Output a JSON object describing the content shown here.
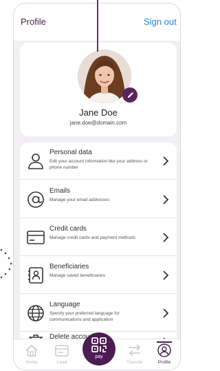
{
  "header": {
    "title": "Profile",
    "sign_out": "Sign out"
  },
  "user": {
    "name": "Jane Doe",
    "email": "jane.doe@domain.com"
  },
  "menu": [
    {
      "icon": "person-icon",
      "title": "Personal data",
      "desc": "Edit your account information like your address or phone number"
    },
    {
      "icon": "at-icon",
      "title": "Emails",
      "desc": "Manage your email addresses"
    },
    {
      "icon": "credit-card-icon",
      "title": "Credit cards",
      "desc": "Manage credit cards and payment methods"
    },
    {
      "icon": "contact-book-icon",
      "title": "Beneficiaries",
      "desc": "Manage saved beneficiaries"
    },
    {
      "icon": "globe-icon",
      "title": "Language",
      "desc": "Specify your preferred language for communications and application"
    },
    {
      "icon": "trash-icon",
      "title": "Delete account",
      "desc": ""
    }
  ],
  "nav": {
    "home": "Home",
    "load": "Load",
    "pay": "pay",
    "transfer": "Transfer",
    "profile": "Profile"
  },
  "colors": {
    "primary": "#4a1d4f",
    "link": "#1e88e5",
    "background": "#f1eff2"
  }
}
